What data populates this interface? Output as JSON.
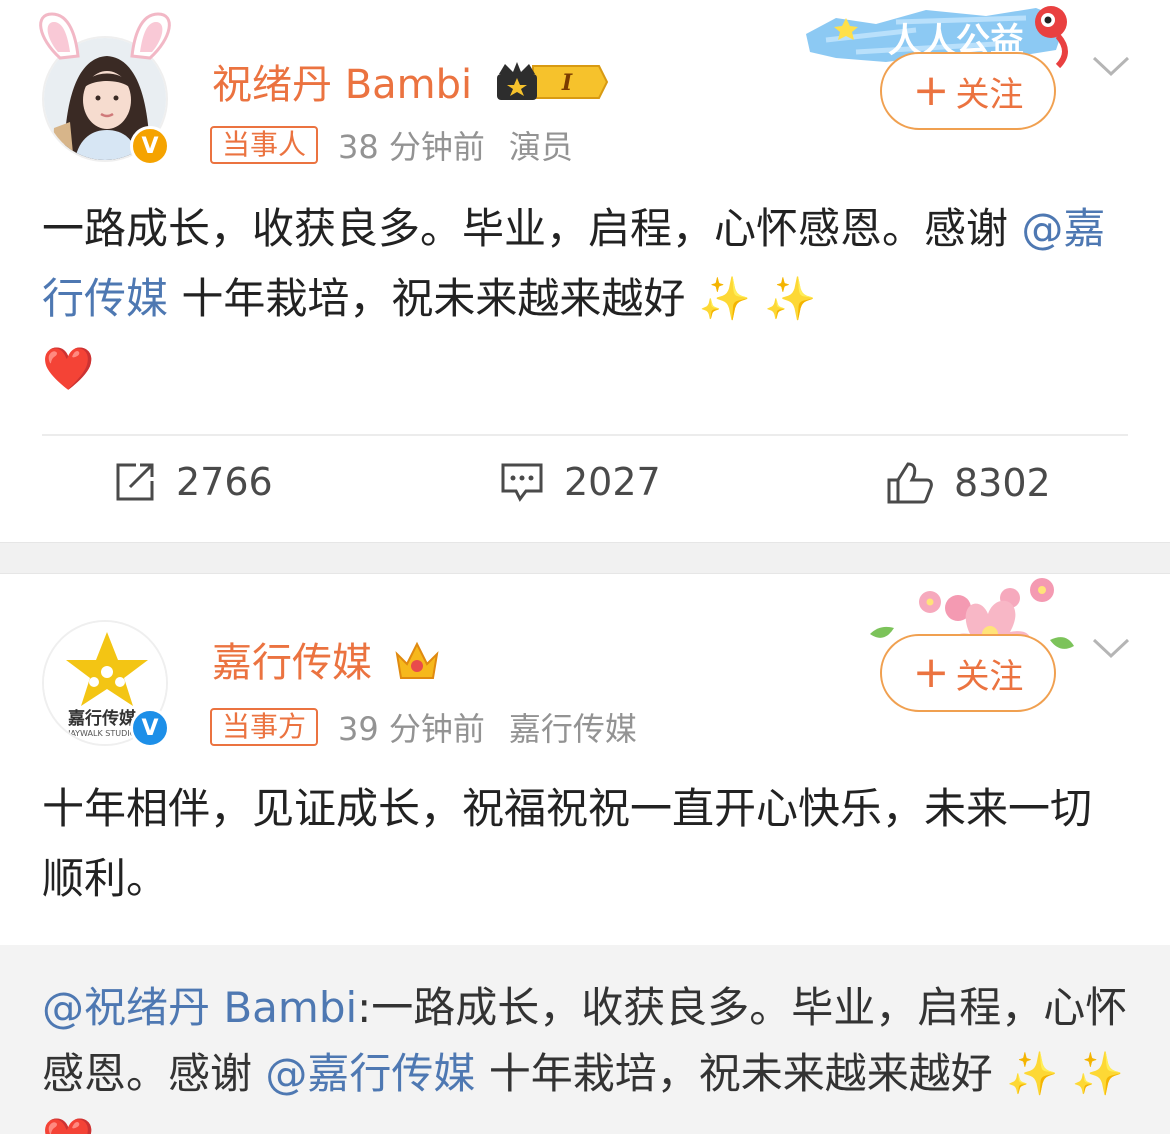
{
  "post1": {
    "author": "祝绪丹 Bambi",
    "level_badge": "I",
    "tag": "当事人",
    "time": "38 分钟前",
    "source": "演员",
    "follow_label": "关注",
    "banner_text": "人人公益",
    "text_a": "一路成长，收获良多。毕业，启程，心怀感恩。感谢 ",
    "mention": "@嘉行传媒",
    "text_b": " 十年栽培，祝未来越来越好 ✨ ✨",
    "heart": "❤️",
    "actions": {
      "repost": "2766",
      "comment": "2027",
      "like": "8302"
    }
  },
  "post2": {
    "author": "嘉行传媒",
    "logo_text": "嘉行传媒",
    "logo_sub": "JAYWALK STUDIO",
    "tag": "当事方",
    "time": "39 分钟前",
    "source": "嘉行传媒",
    "follow_label": "关注",
    "text": "十年相伴，见证成长，祝福祝祝一直开心快乐，未来一切顺利。",
    "quote": {
      "mention_author": "@祝绪丹 Bambi",
      "text_a": ":一路成长，收获良多。毕业，启程，心怀感恩。感谢 ",
      "mention": "@嘉行传媒",
      "text_b": " 十年栽培，祝未来越来越好 ✨ ✨ ❤️"
    }
  },
  "colors": {
    "accent": "#eb7340",
    "mention": "#4e78b2",
    "verified_orange": "#f5a300",
    "verified_blue": "#1d8fe8"
  }
}
